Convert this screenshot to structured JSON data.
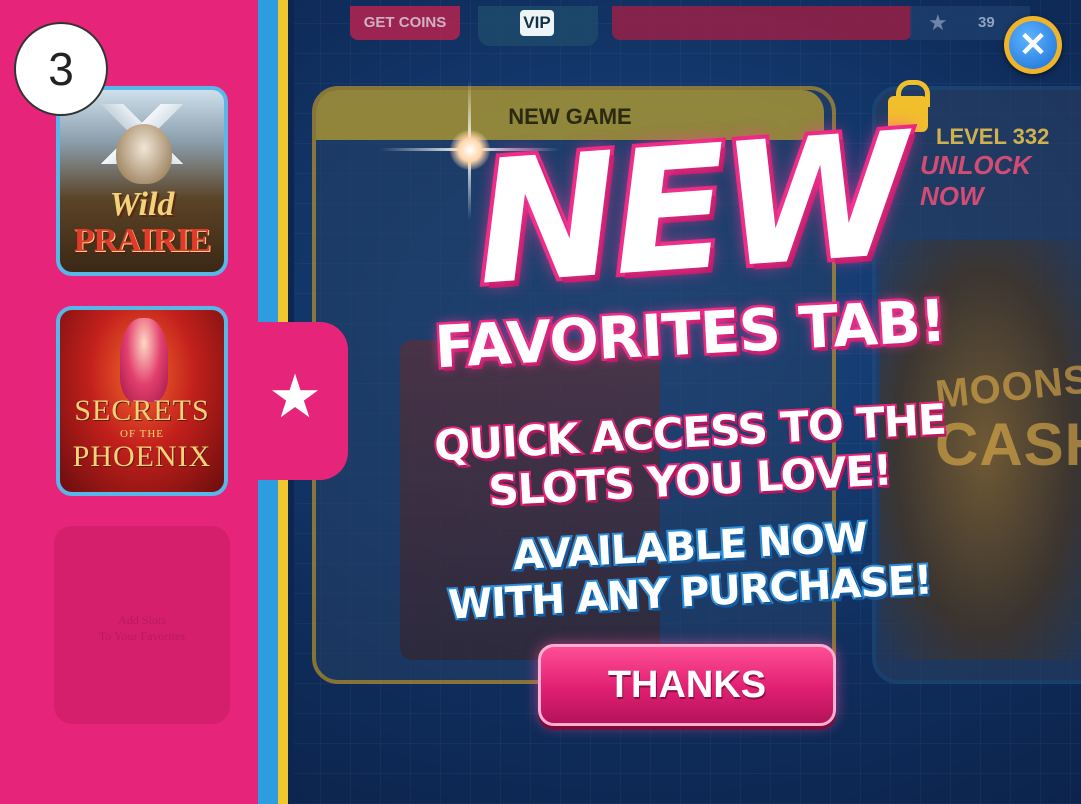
{
  "step_number": "3",
  "topbar": {
    "get_coins_label": "GET COINS",
    "vip_label": "VIP",
    "player_level_value": "39"
  },
  "close_button": {
    "icon": "close-x-icon",
    "glyph": "✕"
  },
  "background_cards": {
    "new_game_header": "NEW GAME",
    "locked_level_text": "LEVEL 332",
    "locked_unlock_text": "UNLOCK NOW",
    "moonshine_title": "MOONSHINE",
    "cash_title": "CASH"
  },
  "sidebar": {
    "favorites_tab_icon": "star-icon",
    "favorites_tab_glyph": "★",
    "slots": [
      {
        "wild_line": "Wild",
        "prairie_line": "PRAIRIE"
      },
      {
        "secrets_line": "SECRETS",
        "of_the_line": "OF THE",
        "phoenix_line": "PHOENIX"
      }
    ],
    "empty_slot_text_line1": "Add Slots",
    "empty_slot_text_line2": "To Your Favorites"
  },
  "promo": {
    "headline": "NEW",
    "subheadline": "FAVORITES TAB!",
    "quick_line1": "QUICK ACCESS TO THE",
    "quick_line2": "SLOTS YOU LOVE!",
    "avail_line1": "AVAILABLE NOW",
    "avail_line2": "WITH ANY PURCHASE!"
  },
  "thanks_button_label": "THANKS",
  "colors": {
    "sidebar_pink": "#e6257a",
    "accent_blue": "#2c9de1",
    "accent_yellow": "#f1c72d",
    "button_pink": "#e01f72"
  }
}
